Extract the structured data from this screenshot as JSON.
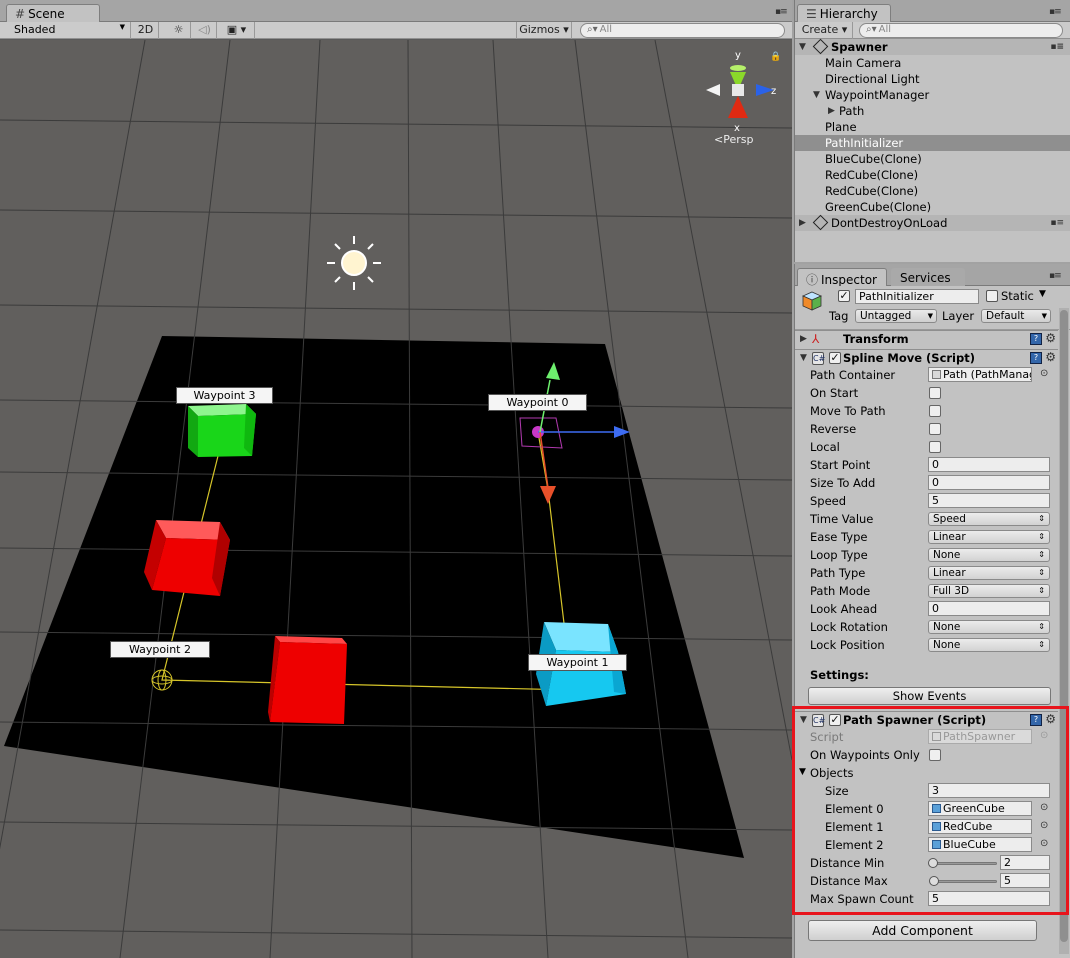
{
  "scene": {
    "tab_label": "Scene",
    "shading_mode": "Shaded",
    "mode_2d_label": "2D",
    "gizmos_label": "Gizmos",
    "search_placeholder": "All",
    "persp_label": "Persp",
    "axis_labels": {
      "y": "y",
      "z": "z",
      "x": "x"
    },
    "waypoints": [
      "Waypoint 0",
      "Waypoint 1",
      "Waypoint 2",
      "Waypoint 3"
    ],
    "colors": {
      "viewport_bg": "#615f5d",
      "plane": "#000000",
      "green_cube": "#19d619",
      "red_cube": "#ee0000",
      "blue_cube": "#16c8f0",
      "path_line": "#d6c52a"
    }
  },
  "hierarchy": {
    "tab_label": "Hierarchy",
    "create_label": "Create",
    "search_placeholder": "All",
    "scenes": [
      {
        "name": "Spawner",
        "items": [
          {
            "label": "Main Camera"
          },
          {
            "label": "Directional Light"
          },
          {
            "label": "WaypointManager"
          },
          {
            "label": "Path"
          },
          {
            "label": "Plane"
          },
          {
            "label": "PathInitializer"
          },
          {
            "label": "BlueCube(Clone)"
          },
          {
            "label": "RedCube(Clone)"
          },
          {
            "label": "RedCube(Clone)"
          },
          {
            "label": "GreenCube(Clone)"
          }
        ]
      },
      {
        "name": "DontDestroyOnLoad"
      }
    ]
  },
  "inspector": {
    "tab_label": "Inspector",
    "services_label": "Services",
    "object_name": "PathInitializer",
    "static_label": "Static",
    "tag_label": "Tag",
    "tag_value": "Untagged",
    "layer_label": "Layer",
    "layer_value": "Default",
    "transform_title": "Transform",
    "spline_move": {
      "title": "Spline Move (Script)",
      "path_container_label": "Path Container",
      "path_container_value": "Path (PathManager)",
      "on_start_label": "On Start",
      "move_to_path_label": "Move To Path",
      "reverse_label": "Reverse",
      "local_label": "Local",
      "start_point_label": "Start Point",
      "start_point_value": "0",
      "size_to_add_label": "Size To Add",
      "size_to_add_value": "0",
      "speed_label": "Speed",
      "speed_value": "5",
      "time_value_label": "Time Value",
      "time_value_value": "Speed",
      "ease_type_label": "Ease Type",
      "ease_type_value": "Linear",
      "loop_type_label": "Loop Type",
      "loop_type_value": "None",
      "path_type_label": "Path Type",
      "path_type_value": "Linear",
      "path_mode_label": "Path Mode",
      "path_mode_value": "Full 3D",
      "look_ahead_label": "Look Ahead",
      "look_ahead_value": "0",
      "lock_rotation_label": "Lock Rotation",
      "lock_rotation_value": "None",
      "lock_position_label": "Lock Position",
      "lock_position_value": "None",
      "settings_label": "Settings:",
      "show_events_label": "Show Events"
    },
    "path_spawner": {
      "title": "Path Spawner (Script)",
      "script_label": "Script",
      "script_value": "PathSpawner",
      "on_waypoints_only_label": "On Waypoints Only",
      "objects_label": "Objects",
      "size_label": "Size",
      "size_value": "3",
      "elements": [
        {
          "label": "Element 0",
          "value": "GreenCube"
        },
        {
          "label": "Element 1",
          "value": "RedCube"
        },
        {
          "label": "Element 2",
          "value": "BlueCube"
        }
      ],
      "distance_min_label": "Distance Min",
      "distance_min_value": "2",
      "distance_max_label": "Distance Max",
      "distance_max_value": "5",
      "max_spawn_count_label": "Max Spawn Count",
      "max_spawn_count_value": "5"
    },
    "add_component_label": "Add Component"
  },
  "highlight_color": "#e8141c"
}
